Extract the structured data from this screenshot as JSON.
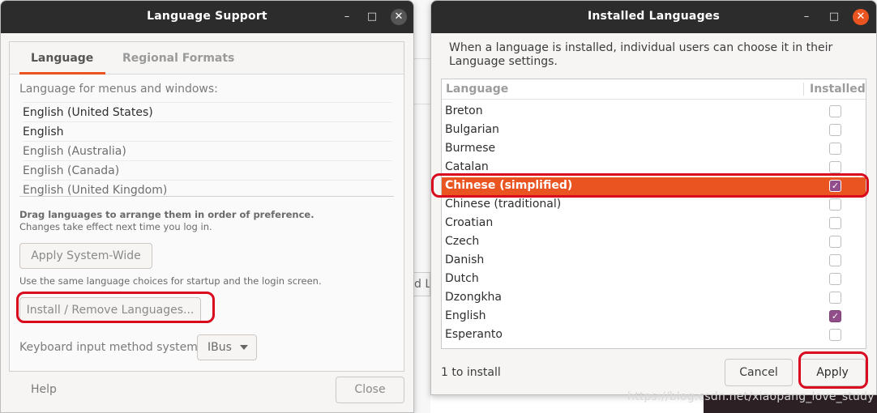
{
  "language_support": {
    "title": "Language Support",
    "tabs": [
      "Language",
      "Regional Formats"
    ],
    "menus_label": "Language for menus and windows:",
    "languages": [
      {
        "name": "English (United States)",
        "primary": true
      },
      {
        "name": "English",
        "primary": true
      },
      {
        "name": "English (Australia)",
        "primary": false
      },
      {
        "name": "English (Canada)",
        "primary": false
      },
      {
        "name": "English (United Kingdom)",
        "primary": false
      }
    ],
    "drag_hint_bold": "Drag languages to arrange them in order of preference.",
    "drag_hint": "Changes take effect next time you log in.",
    "apply_system_wide": "Apply System-Wide",
    "same_choices_hint": "Use the same language choices for startup and the login screen.",
    "install_remove": "Install / Remove Languages...",
    "keyboard_label": "Keyboard input method system:",
    "keyboard_value": "IBus",
    "help": "Help",
    "close": "Close"
  },
  "installed_languages": {
    "title": "Installed Languages",
    "description": "When a language is installed, individual users can choose it in their Language settings.",
    "columns": [
      "Language",
      "Installed"
    ],
    "rows": [
      {
        "name": "Breton",
        "installed": false,
        "selected": false
      },
      {
        "name": "Bulgarian",
        "installed": false,
        "selected": false
      },
      {
        "name": "Burmese",
        "installed": false,
        "selected": false
      },
      {
        "name": "Catalan",
        "installed": false,
        "selected": false
      },
      {
        "name": "Chinese (simplified)",
        "installed": true,
        "selected": true
      },
      {
        "name": "Chinese (traditional)",
        "installed": false,
        "selected": false
      },
      {
        "name": "Croatian",
        "installed": false,
        "selected": false
      },
      {
        "name": "Czech",
        "installed": false,
        "selected": false
      },
      {
        "name": "Danish",
        "installed": false,
        "selected": false
      },
      {
        "name": "Dutch",
        "installed": false,
        "selected": false
      },
      {
        "name": "Dzongkha",
        "installed": false,
        "selected": false
      },
      {
        "name": "English",
        "installed": true,
        "selected": false
      },
      {
        "name": "Esperanto",
        "installed": false,
        "selected": false
      }
    ],
    "status": "1 to install",
    "cancel": "Cancel",
    "apply": "Apply"
  },
  "background_fragment": "d La",
  "watermark": "https://blog.csdn.net/xiaopang_love_study",
  "colors": {
    "accent": "#e95420",
    "titlebar": "#2c2c2c",
    "checkbox_on": "#924d8b",
    "annotation": "#d9091e"
  }
}
